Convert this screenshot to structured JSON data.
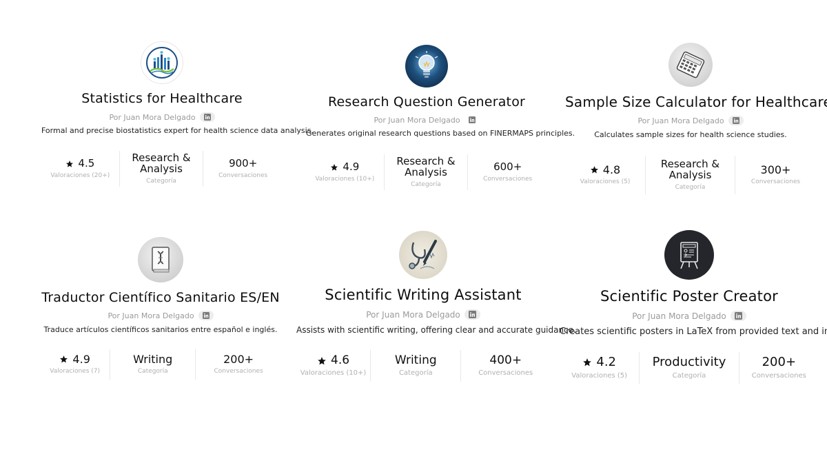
{
  "linkedin_label": "in",
  "cards": [
    {
      "title": "Statistics for Healthcare",
      "author": "Por Juan Mora Delgado",
      "description": "Formal and precise biostatistics expert for health science data analysis.",
      "rating": "4.5",
      "ratings_label": "Valoraciones (20+)",
      "category": "Research & Analysis",
      "category_label": "Categoría",
      "conversations": "900+",
      "conversations_label": "Conversaciones",
      "icon": "statistics-chart-icon"
    },
    {
      "title": "Research Question Generator",
      "author": "Por Juan Mora Delgado",
      "description": "Generates original research questions based on FINERMAPS principles.",
      "rating": "4.9",
      "ratings_label": "Valoraciones (10+)",
      "category": "Research & Analysis",
      "category_label": "Categoría",
      "conversations": "600+",
      "conversations_label": "Conversaciones",
      "icon": "lightbulb-icon"
    },
    {
      "title": "Sample Size Calculator for Healthcare",
      "author": "Por Juan Mora Delgado",
      "description": "Calculates sample sizes for health science studies.",
      "rating": "4.8",
      "ratings_label": "Valoraciones (5)",
      "category": "Research & Analysis",
      "category_label": "Categoría",
      "conversations": "300+",
      "conversations_label": "Conversaciones",
      "icon": "calculator-icon"
    },
    {
      "title": "Traductor Científico Sanitario ES/EN",
      "author": "Por Juan Mora Delgado",
      "description": "Traduce artículos científicos sanitarios entre español e inglés.",
      "rating": "4.9",
      "ratings_label": "Valoraciones (7)",
      "category": "Writing",
      "category_label": "Categoría",
      "conversations": "200+",
      "conversations_label": "Conversaciones",
      "icon": "dna-book-icon"
    },
    {
      "title": "Scientific Writing Assistant",
      "author": "Por Juan Mora Delgado",
      "description": "Assists with scientific writing, offering clear and accurate guidance.",
      "rating": "4.6",
      "ratings_label": "Valoraciones (10+)",
      "category": "Writing",
      "category_label": "Categoría",
      "conversations": "400+",
      "conversations_label": "Conversaciones",
      "icon": "stethoscope-pen-icon"
    },
    {
      "title": "Scientific Poster Creator",
      "author": "Por Juan Mora Delgado",
      "description": "Creates scientific posters in LaTeX from provided text and images.",
      "rating": "4.2",
      "ratings_label": "Valoraciones (5)",
      "category": "Productivity",
      "category_label": "Categoría",
      "conversations": "200+",
      "conversations_label": "Conversaciones",
      "icon": "poster-easel-icon"
    }
  ]
}
